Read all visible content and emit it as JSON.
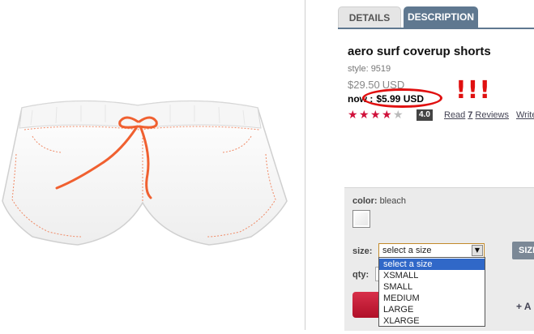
{
  "tabs": {
    "details": "DETAILS",
    "description": "DESCRIPTION"
  },
  "product": {
    "title": "aero surf coverup shorts",
    "style_label": "style:",
    "style_number": "9519",
    "was_price": "$29.50",
    "was_currency": "USD",
    "now_label": "now :",
    "now_price": "$5.99 USD",
    "annotation": "!!!"
  },
  "rating": {
    "stars_on": 4,
    "stars_total": 5,
    "score": "4.0",
    "reviews_prefix": "Read",
    "reviews_count": "7",
    "reviews_suffix": "Reviews",
    "write_link": "Write"
  },
  "options": {
    "color_label": "color:",
    "color_value": "bleach",
    "size_label": "size:",
    "size_selected": "select a size",
    "size_options": [
      "select a size",
      "XSMALL",
      "SMALL",
      "MEDIUM",
      "LARGE",
      "XLARGE"
    ],
    "size_guide": "SIZE",
    "qty_label": "qty:",
    "wishlist": "+ A"
  },
  "colors": {
    "tab_active": "#5f7890",
    "price_alert": "#e01010",
    "star": "#d0103a",
    "add_button": "#c01c36",
    "dropdown_highlight": "#3068c8"
  },
  "icons": {
    "dropdown": "chevron-down-icon",
    "star": "star-icon"
  }
}
